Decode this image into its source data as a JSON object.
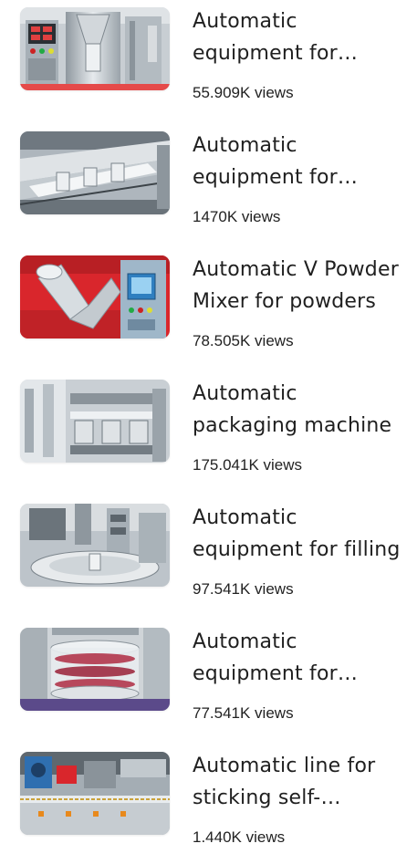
{
  "videos": [
    {
      "title": "Automatic equipment for packaging",
      "views": "55.909K views",
      "thumb_icon": "vertical-packing-machine"
    },
    {
      "title": "Automatic equipment for packaging",
      "views": "1470K views",
      "thumb_icon": "conveyor-line"
    },
    {
      "title": "Automatic V Powder Mixer for powders",
      "views": "78.505K views",
      "thumb_icon": "v-powder-mixer"
    },
    {
      "title": "Automatic packaging machine",
      "views": "175.041K views",
      "thumb_icon": "packaging-line"
    },
    {
      "title": "Automatic equipment for filling",
      "views": "97.541K views",
      "thumb_icon": "rotary-filler"
    },
    {
      "title": "Automatic equipment for tablets",
      "views": "77.541K views",
      "thumb_icon": "rotary-tablet-chamber"
    },
    {
      "title": "Automatic line for sticking self-adhesive labels",
      "views": "1.440K views",
      "thumb_icon": "labeling-line"
    }
  ],
  "colors": {
    "title": "#1f1f1f",
    "views": "#222222",
    "steel": "#b9c0c6",
    "accent_red": "#d9262c",
    "accent_blue": "#2f7fc0"
  }
}
